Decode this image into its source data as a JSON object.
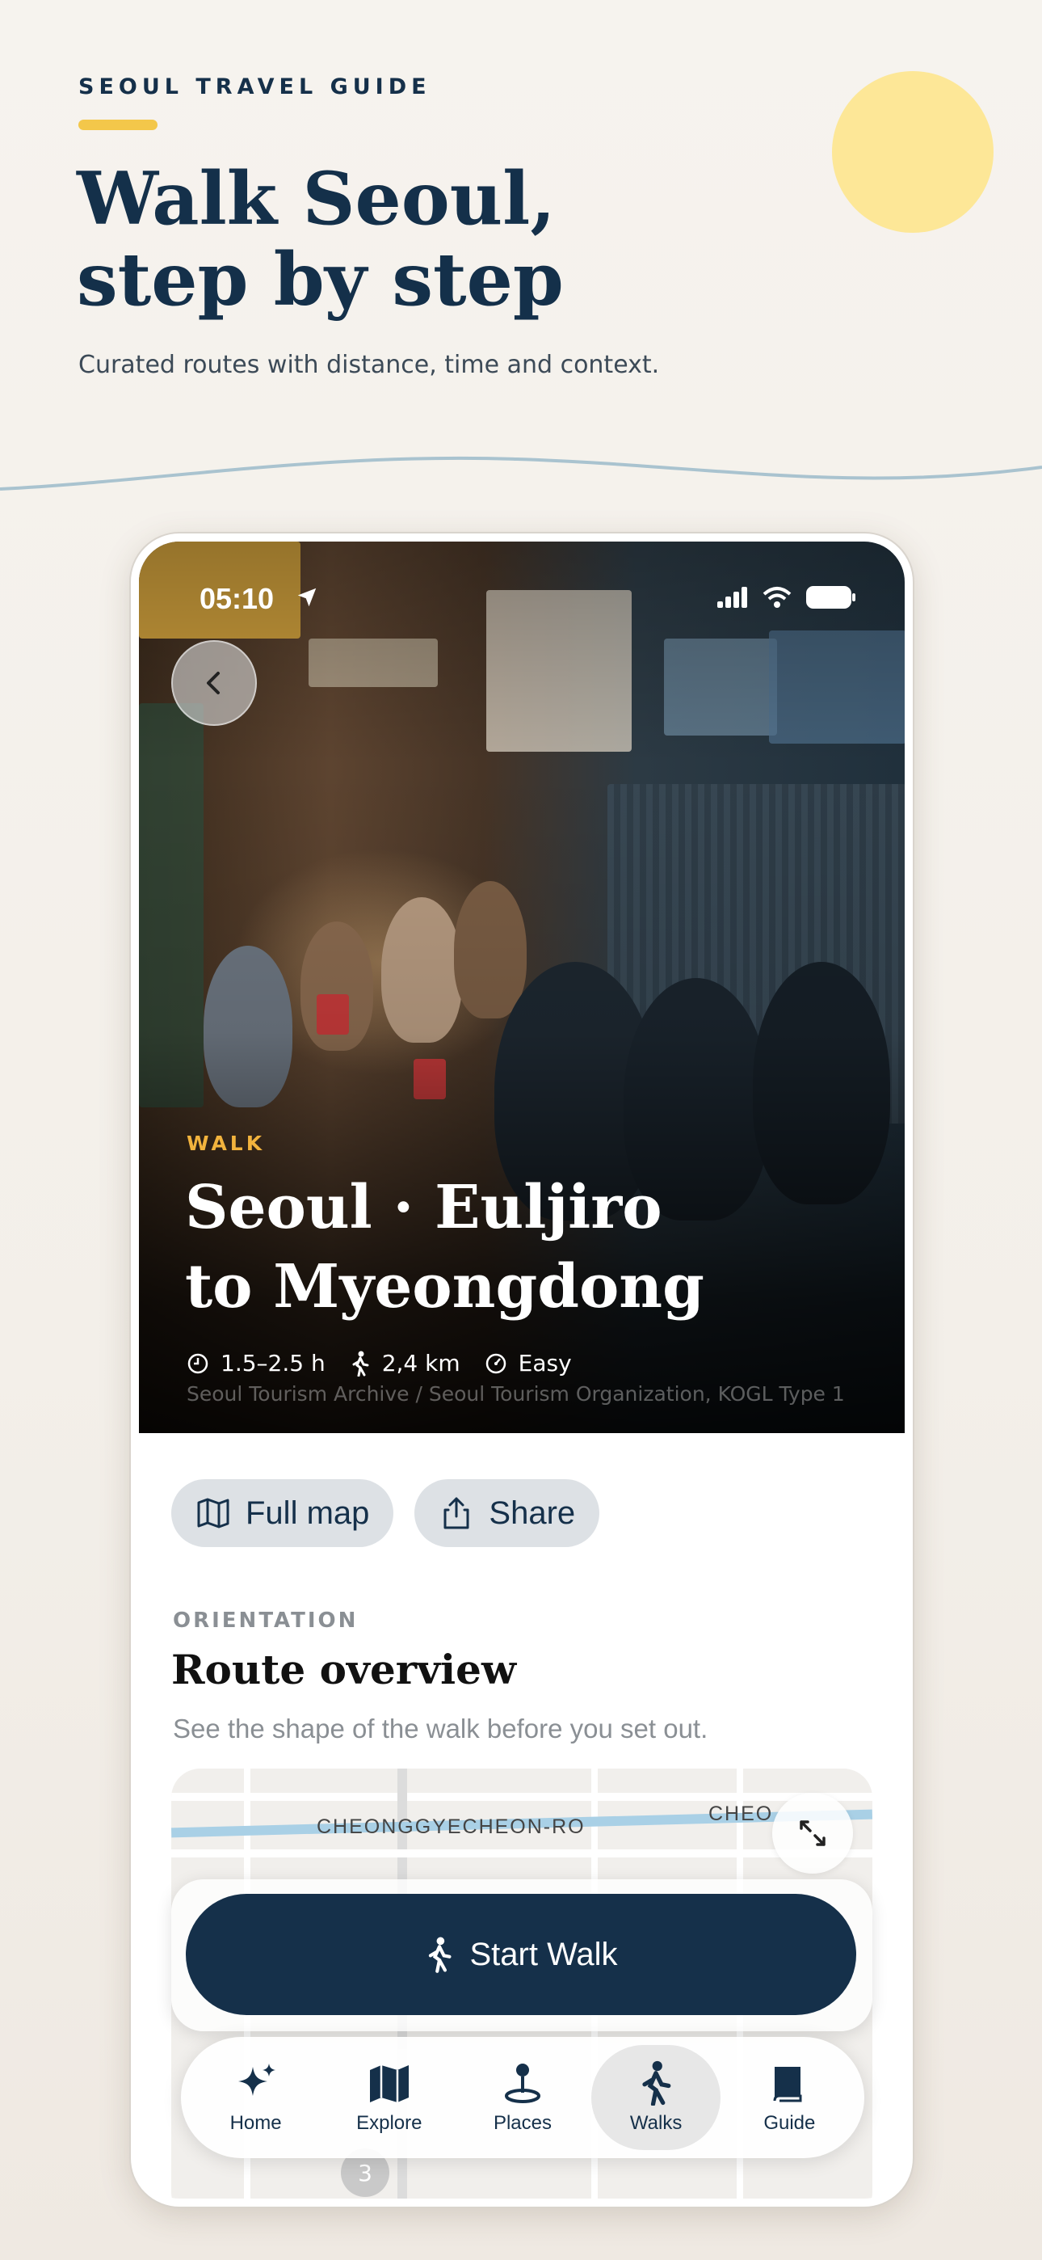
{
  "header": {
    "eyebrow": "SEOUL TRAVEL GUIDE",
    "headline_line1": "Walk Seoul,",
    "headline_line2": "step by step",
    "subtitle": "Curated routes with distance, time and context."
  },
  "status_bar": {
    "time": "05:10"
  },
  "hero": {
    "kicker": "WALK",
    "title_line1": "Seoul · Euljiro",
    "title_line2": "to Myeongdong",
    "duration": "1.5–2.5 h",
    "distance": "2,4 km",
    "difficulty": "Easy",
    "credit": "Seoul Tourism Archive / Seoul Tourism Organization, KOGL Type 1"
  },
  "actions": {
    "full_map": "Full map",
    "share": "Share"
  },
  "overview": {
    "kicker": "ORIENTATION",
    "title": "Route overview",
    "subtitle": "See the shape of the walk before you set out."
  },
  "map": {
    "label_main": "CHEONGGYECHEON-RO",
    "label_right": "CHEO",
    "marker": "3"
  },
  "cta": {
    "start_walk": "Start Walk"
  },
  "tabs": [
    {
      "label": "Home",
      "icon": "sparkles-icon"
    },
    {
      "label": "Explore",
      "icon": "map-icon"
    },
    {
      "label": "Places",
      "icon": "location-pin-icon"
    },
    {
      "label": "Walks",
      "icon": "walking-person-icon",
      "active": true
    },
    {
      "label": "Guide",
      "icon": "book-icon"
    }
  ],
  "colors": {
    "navy": "#15304a",
    "accent": "#f3c74a",
    "kicker": "#f2b33d"
  }
}
